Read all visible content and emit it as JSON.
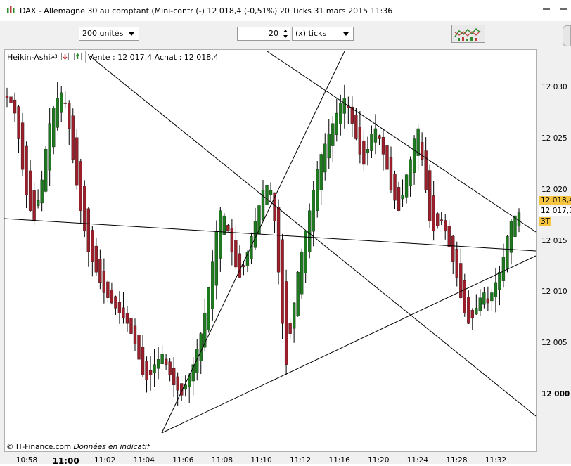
{
  "window": {
    "title": "DAX - Allemagne 30 au comptant (Mini-contr (-)   12 018,4 (-0,51%)   20 Ticks  31 mars 2015 11:36"
  },
  "toolbar": {
    "units_select": "200 unités",
    "ticks_value": "20",
    "ticks_select": "(x) ticks",
    "indicator_button_icon": "indicators-icon"
  },
  "chart_header": {
    "chart_style": "Heikin-Ashi",
    "quote": "Vente : 12 017,4  Achat : 12 018,4"
  },
  "price_badges": {
    "ask": "12 018,4",
    "bid": "12 017,7",
    "ticks": "3T"
  },
  "footer": {
    "copyright": "© IT-Finance.com",
    "note": "Données en indicatif"
  },
  "colors": {
    "up_candle": "#1e7a1e",
    "down_candle": "#9a1f2b",
    "wick": "#000000",
    "ask_badge": "#f5c542",
    "bid_badge": "#ffffff",
    "ticks_badge": "#f5c542"
  },
  "chart_data": {
    "type": "candlestick",
    "chart_style": "Heikin-Ashi",
    "ylim": [
      11999,
      12031
    ],
    "y_ticks": [
      {
        "v": 12030,
        "label": "12 030",
        "bold": false
      },
      {
        "v": 12025,
        "label": "12 025",
        "bold": false
      },
      {
        "v": 12020,
        "label": "12 020",
        "bold": false
      },
      {
        "v": 12015,
        "label": "12 015",
        "bold": false
      },
      {
        "v": 12010,
        "label": "12 010",
        "bold": false
      },
      {
        "v": 12005,
        "label": "12 005",
        "bold": false
      },
      {
        "v": 12000,
        "label": "12 000",
        "bold": true
      }
    ],
    "x_ticks": [
      {
        "label": "10:58",
        "bold": false
      },
      {
        "label": "11:00",
        "bold": true
      },
      {
        "label": "11:02",
        "bold": false
      },
      {
        "label": "11:04",
        "bold": false
      },
      {
        "label": "11:06",
        "bold": false
      },
      {
        "label": "11:08",
        "bold": false
      },
      {
        "label": "11:10",
        "bold": false
      },
      {
        "label": "11:12",
        "bold": false
      },
      {
        "label": "11:16",
        "bold": false
      },
      {
        "label": "11:20",
        "bold": false
      },
      {
        "label": "11:24",
        "bold": false
      },
      {
        "label": "11:28",
        "bold": false
      },
      {
        "label": "11:32",
        "bold": false
      }
    ],
    "closes": [
      12029,
      12028.5,
      12027.5,
      12025,
      12022,
      12019.5,
      12018,
      12017,
      12019,
      12021,
      12024,
      12026.5,
      12028,
      12029,
      12029.5,
      12028.5,
      12026,
      12023,
      12020.5,
      12018,
      12016,
      12014,
      12013,
      12012,
      12011,
      12010,
      12009.5,
      12009,
      12008.5,
      12008,
      12007.5,
      12007,
      12006,
      12005,
      12003.5,
      12002,
      12001.5,
      12002,
      12003,
      12003.5,
      12004,
      12003,
      12002,
      12001,
      12000.5,
      12000,
      12001,
      12002,
      12003,
      12004.5,
      12006,
      12008,
      12010.5,
      12013,
      12016,
      12018,
      12017.5,
      12016,
      12014,
      12012.5,
      12011.5,
      12012.5,
      12014,
      12015.5,
      12017,
      12018.5,
      12020,
      12020.5,
      12020,
      12017,
      12012,
      12007,
      12003,
      12006,
      12009,
      12012,
      12014,
      12016,
      12018,
      12020,
      12022,
      12023.5,
      12024.5,
      12025.5,
      12026.5,
      12027.5,
      12028.5,
      12029,
      12028,
      12026.5,
      12025,
      12023.5,
      12022.5,
      12024,
      12025.5,
      12026,
      12025,
      12023.5,
      12022,
      12020,
      12019,
      12018,
      12019.5,
      12021.5,
      12023,
      12025,
      12026,
      12023,
      12020,
      12017,
      12016,
      12016.5,
      12017,
      12016,
      12014.5,
      12013,
      12011.5,
      12009.5,
      12008,
      12007,
      12007.5,
      12008.5,
      12009.5,
      12010,
      12009,
      12010,
      12011,
      12012,
      12013.5,
      12015.5,
      12017,
      12017.5,
      12017.8
    ]
  }
}
